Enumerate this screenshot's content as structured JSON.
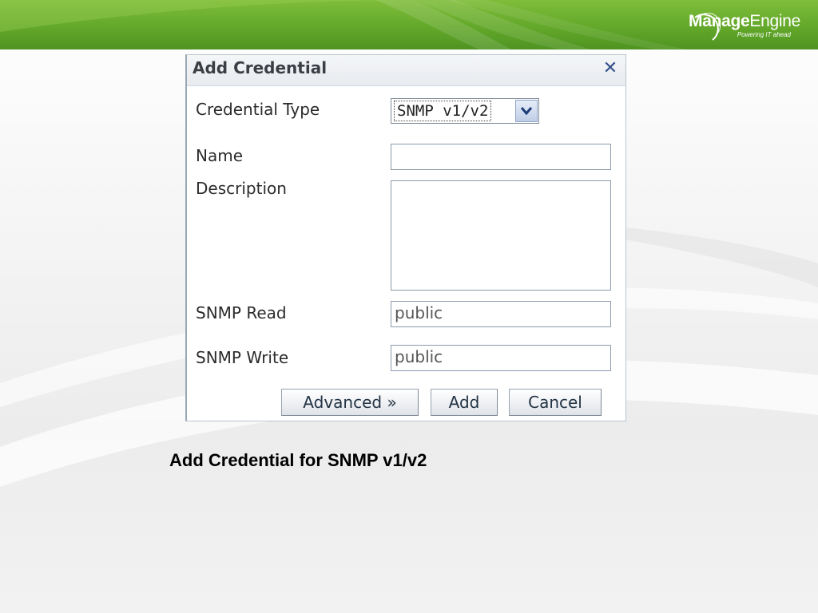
{
  "brand": {
    "name_bold": "Manage",
    "name_light": "Engine",
    "tagline": "Powering IT ahead"
  },
  "dialog": {
    "title": "Add Credential",
    "close_icon": "close-icon",
    "fields": {
      "credential_type": {
        "label": "Credential Type",
        "value": "SNMP v1/v2"
      },
      "name": {
        "label": "Name",
        "value": ""
      },
      "description": {
        "label": "Description",
        "value": ""
      },
      "snmp_read": {
        "label": "SNMP Read",
        "value": "public"
      },
      "snmp_write": {
        "label": "SNMP Write",
        "value": "public"
      }
    },
    "buttons": {
      "advanced": "Advanced »",
      "add": "Add",
      "cancel": "Cancel"
    }
  },
  "caption": "Add Credential for SNMP v1/v2",
  "colors": {
    "header_green": "#63a82a",
    "close_icon_blue": "#35518a"
  }
}
